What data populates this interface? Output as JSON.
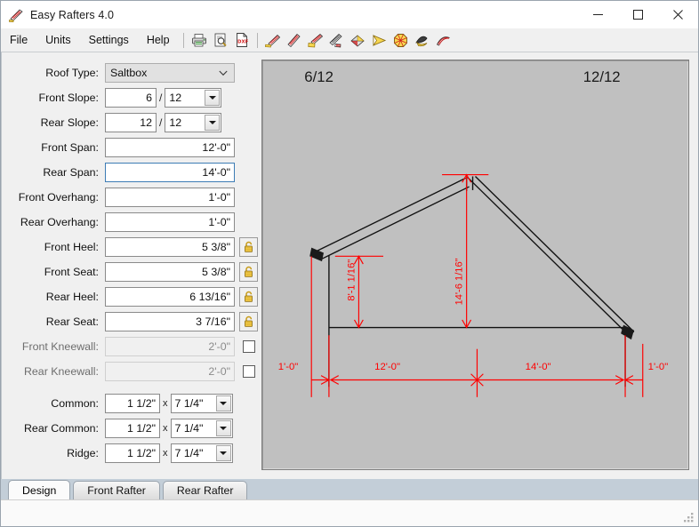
{
  "window": {
    "title": "Easy Rafters 4.0",
    "app_icon": "rafter-icon",
    "controls": [
      {
        "name": "minimize-button",
        "glyph": "minimize-icon"
      },
      {
        "name": "maximize-button",
        "glyph": "maximize-icon"
      },
      {
        "name": "close-button",
        "glyph": "close-icon"
      }
    ]
  },
  "menu": {
    "items": [
      "File",
      "Units",
      "Settings",
      "Help"
    ]
  },
  "toolbar": {
    "buttons": [
      {
        "name": "print-button",
        "icon": "printer-icon"
      },
      {
        "name": "print-preview-button",
        "icon": "print-preview-icon"
      },
      {
        "name": "export-dxf-button",
        "icon": "dxf-file-icon"
      },
      {
        "name": "common-rafter-button",
        "icon": "rafter-red-icon"
      },
      {
        "name": "hip-rafter-button",
        "icon": "rafter-tilt-icon"
      },
      {
        "name": "valley-rafter-button",
        "icon": "rafter-yellow-icon"
      },
      {
        "name": "jack-rafter-button",
        "icon": "rafter-stack-icon"
      },
      {
        "name": "roof-plan-button",
        "icon": "roof-plan-icon"
      },
      {
        "name": "angle-tool-button",
        "icon": "protractor-icon"
      },
      {
        "name": "octagon-tool-button",
        "icon": "octagon-roof-icon"
      },
      {
        "name": "cone-roof-button",
        "icon": "cone-roof-icon"
      },
      {
        "name": "curved-rafter-button",
        "icon": "curved-rafter-icon"
      }
    ]
  },
  "form": {
    "roof_type": {
      "label": "Roof Type:",
      "value": "Saltbox"
    },
    "front_slope": {
      "label": "Front Slope:",
      "rise": "6",
      "run": "12",
      "separator": "/"
    },
    "rear_slope": {
      "label": "Rear Slope:",
      "rise": "12",
      "run": "12",
      "separator": "/"
    },
    "front_span": {
      "label": "Front Span:",
      "value": "12'-0\""
    },
    "rear_span": {
      "label": "Rear Span:",
      "value": "14'-0\"",
      "focused": true
    },
    "front_overhang": {
      "label": "Front Overhang:",
      "value": "1'-0\""
    },
    "rear_overhang": {
      "label": "Rear Overhang:",
      "value": "1'-0\""
    },
    "front_heel": {
      "label": "Front Heel:",
      "value": "5 3/8\"",
      "lock": "unlocked-padlock-icon"
    },
    "front_seat": {
      "label": "Front Seat:",
      "value": "5 3/8\"",
      "lock": "unlocked-padlock-icon"
    },
    "rear_heel": {
      "label": "Rear Heel:",
      "value": "6 13/16\"",
      "lock": "unlocked-padlock-icon"
    },
    "rear_seat": {
      "label": "Rear Seat:",
      "value": "3 7/16\"",
      "lock": "unlocked-padlock-icon"
    },
    "front_kneewall": {
      "label": "Front Kneewall:",
      "value": "2'-0\"",
      "disabled": true,
      "checked": false
    },
    "rear_kneewall": {
      "label": "Rear Kneewall:",
      "value": "2'-0\"",
      "disabled": true,
      "checked": false
    },
    "common": {
      "label": "Common:",
      "width": "1 1/2\"",
      "depth": "7 1/4\"",
      "separator": "x"
    },
    "rear_common": {
      "label": "Rear Common:",
      "width": "1 1/2\"",
      "depth": "7 1/4\"",
      "separator": "x"
    },
    "ridge": {
      "label": "Ridge:",
      "width": "1 1/2\"",
      "depth": "7 1/4\"",
      "separator": "x"
    }
  },
  "drawing": {
    "background_color": "#c0c0c0",
    "dimension_color": "#ff0000",
    "structure_color": "#000000",
    "labels": {
      "front_pitch": "6/12",
      "rear_pitch": "12/12",
      "front_wall_height": "8'-1 1/16\"",
      "ridge_height": "14'-6 1/16\"",
      "front_overhang_dim": "1'-0\"",
      "front_span_dim": "12'-0\"",
      "rear_span_dim": "14'-0\"",
      "rear_overhang_dim": "1'-0\""
    }
  },
  "tabs": [
    {
      "label": "Design",
      "active": true
    },
    {
      "label": "Front Rafter",
      "active": false
    },
    {
      "label": "Rear Rafter",
      "active": false
    }
  ],
  "statusbar": {
    "text": "",
    "grip": "resize-grip-icon"
  }
}
